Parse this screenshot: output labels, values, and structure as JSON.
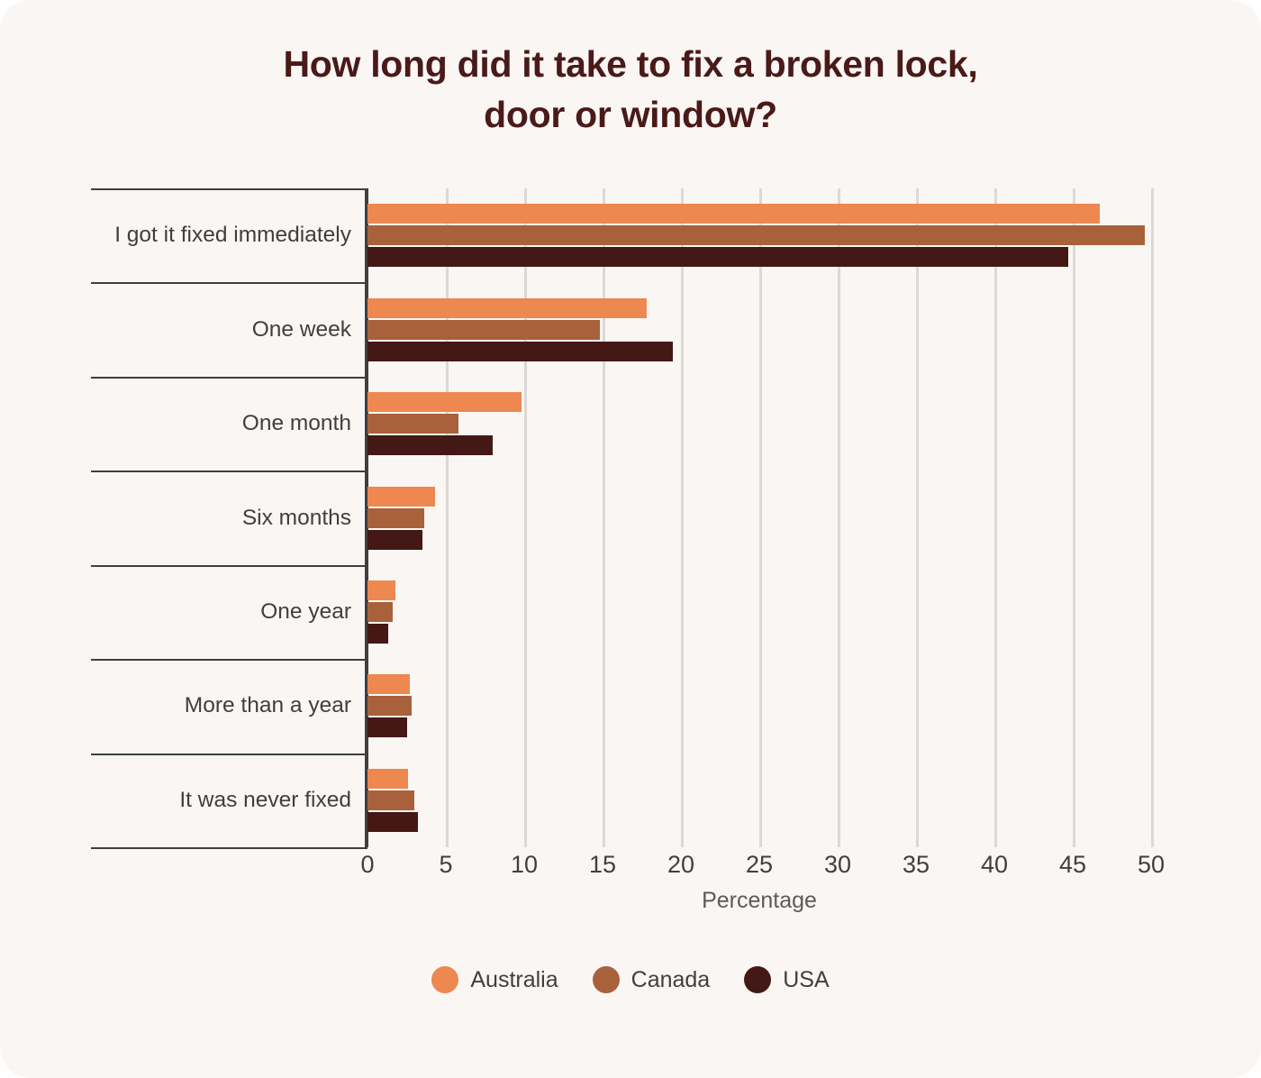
{
  "title": {
    "line1": "How long did it take to fix a broken lock,",
    "line2": "door or window?"
  },
  "colors": {
    "background": "#FAF6F4",
    "title": "#4A1A18",
    "text": "#3F3F3F",
    "grid": "#DDD8D5",
    "axis": "#3F3F3F",
    "australia": "#EC8850",
    "canada": "#A8613A",
    "usa": "#441815"
  },
  "chart_data": {
    "type": "bar",
    "orientation": "horizontal",
    "title": "How long did it take to fix a broken lock, door or window?",
    "xlabel": "Percentage",
    "ylabel": "",
    "xlim": [
      0,
      52.5
    ],
    "xticks": [
      0,
      5,
      10,
      15,
      20,
      25,
      30,
      35,
      40,
      45,
      50
    ],
    "xtick_labels": [
      "0",
      "5",
      "10",
      "15",
      "20",
      "25",
      "30",
      "35",
      "40",
      "45",
      "50"
    ],
    "grid": "vertical",
    "legend_position": "bottom",
    "categories": [
      "I got it fixed immediately",
      "One week",
      "One month",
      "Six months",
      "One year",
      "More than a year",
      "It was never fixed"
    ],
    "series": [
      {
        "name": "Australia",
        "color": "#EC8850",
        "values": [
          46.7,
          17.8,
          9.8,
          4.3,
          1.8,
          2.7,
          2.6
        ]
      },
      {
        "name": "Canada",
        "color": "#A8613A",
        "values": [
          49.6,
          14.8,
          5.8,
          3.6,
          1.6,
          2.8,
          3.0
        ]
      },
      {
        "name": "USA",
        "color": "#441815",
        "values": [
          44.7,
          19.5,
          8.0,
          3.5,
          1.3,
          2.5,
          3.2
        ]
      }
    ]
  },
  "legend": [
    {
      "label": "Australia",
      "color": "#EC8850"
    },
    {
      "label": "Canada",
      "color": "#A8613A"
    },
    {
      "label": "USA",
      "color": "#441815"
    }
  ]
}
